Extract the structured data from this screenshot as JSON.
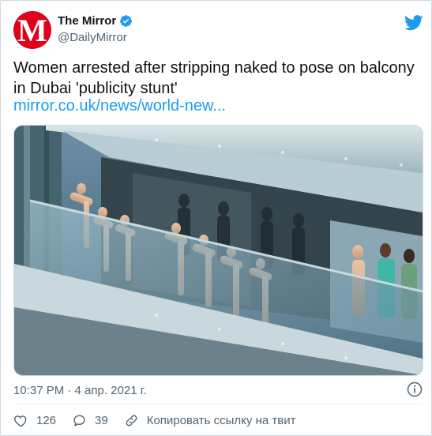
{
  "author": {
    "name": "The Mirror",
    "handle": "@DailyMirror",
    "avatar_letter": "M",
    "avatar_color": "#e0001b",
    "verified": true
  },
  "tweet": {
    "text": "Women arrested after stripping naked to pose on balcony in Dubai 'publicity stunt'",
    "link": "mirror.co.uk/news/world-new...",
    "timestamp": "10:37 PM · 4 апр. 2021 г."
  },
  "actions": {
    "likes": "126",
    "replies": "39",
    "copy_link_label": "Копировать ссылку на твит"
  },
  "colors": {
    "accent": "#1d9bf0",
    "text": "#0f1419",
    "muted": "#536471",
    "like": "#536471"
  },
  "icons": [
    "twitter-bird-icon",
    "verified-badge-icon",
    "info-icon",
    "heart-icon",
    "reply-icon",
    "link-icon"
  ]
}
